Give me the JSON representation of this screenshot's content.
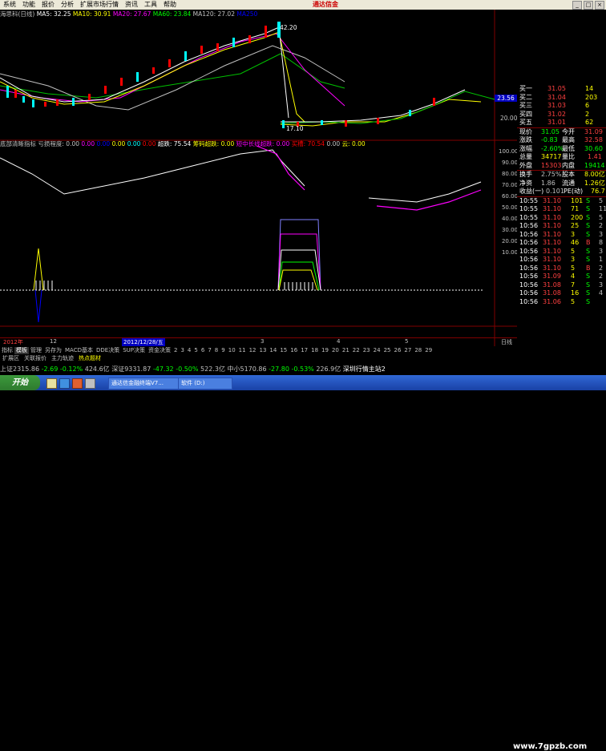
{
  "menu": [
    "系统",
    "功能",
    "报价",
    "分析",
    "扩展市场行情",
    "资讯",
    "工具",
    "帮助"
  ],
  "window_title": "通达信金",
  "ind_top": [
    {
      "t": "海思科(日线)",
      "c": "#c0c0c0"
    },
    {
      "t": "MA5: 32.25",
      "c": "#ffffff"
    },
    {
      "t": "MA10: 30.91",
      "c": "#ffff00"
    },
    {
      "t": "MA20: 27.67",
      "c": "#ff00ff"
    },
    {
      "t": "MA60: 23.84",
      "c": "#00ff00"
    },
    {
      "t": "MA120: 27.02",
      "c": "#c0c0c0"
    },
    {
      "t": "MA250",
      "c": "#0000ff"
    }
  ],
  "price_labels": {
    "hi": "42.20",
    "lo": "17.10",
    "cur": "23.56",
    "p1": "20.00"
  },
  "ind_mid": [
    {
      "t": "底部清晰指标",
      "c": "#c0c0c0"
    },
    {
      "t": "亏损程度: 0.00",
      "c": "#c0c0c0"
    },
    {
      "t": "0.00",
      "c": "#ff00ff"
    },
    {
      "t": "0.00",
      "c": "#0000ff"
    },
    {
      "t": "0.00",
      "c": "#ffff00"
    },
    {
      "t": "0.00",
      "c": "#00ffff"
    },
    {
      "t": "0.00",
      "c": "#ff0000"
    },
    {
      "t": "超跌: 75.54",
      "c": "#ffffff"
    },
    {
      "t": "筹码超跌: 0.00",
      "c": "#ffff00"
    },
    {
      "t": "短中长线超跌: 0.00",
      "c": "#ff00ff"
    },
    {
      "t": "买槽: 70.54",
      "c": "#ff0000"
    },
    {
      "t": "0.00",
      "c": "#c0c0c0"
    },
    {
      "t": "云: 0.00",
      "c": "#ffff00"
    }
  ],
  "axis_mid": [
    "100.00",
    "90.00",
    "80.00",
    "70.00",
    "60.00",
    "50.00",
    "40.00",
    "30.00",
    "20.00",
    "10.00"
  ],
  "time_axis": {
    "left": "2012年",
    "l2": "12",
    "l3": "2012/12/28/五",
    "l4": "3",
    "l5": "4",
    "l6": "5",
    "right": "日线"
  },
  "order_book": [
    {
      "label": "买二",
      "price": "31.04",
      "vol": "203"
    },
    {
      "label": "买三",
      "price": "31.03",
      "vol": "6"
    },
    {
      "label": "买四",
      "price": "31.02",
      "vol": "2"
    },
    {
      "label": "买五",
      "price": "31.01",
      "vol": "62"
    }
  ],
  "order_top": {
    "label": "买一",
    "price": "31.05",
    "vol": "14"
  },
  "quote": [
    {
      "l": "现价",
      "v": "31.05",
      "l2": "今开",
      "v2": "31.09"
    },
    {
      "l": "涨跌",
      "v": "-0.83",
      "l2": "最高",
      "v2": "32.58"
    },
    {
      "l": "涨幅",
      "v": "-2.60%",
      "l2": "最低",
      "v2": "30.60"
    },
    {
      "l": "总量",
      "v": "34717",
      "l2": "量比",
      "v2": "1.41"
    },
    {
      "l": "外盘",
      "v": "15303",
      "l2": "内盘",
      "v2": "19414"
    },
    {
      "l": "换手",
      "v": "2.75%",
      "l2": "股本",
      "v2": "8.00亿"
    },
    {
      "l": "净资",
      "v": "1.86",
      "l2": "流通",
      "v2": "1.26亿"
    },
    {
      "l": "收益(一)",
      "v": "0.101",
      "l2": "PE(动)",
      "v2": "76.7"
    }
  ],
  "ticks": [
    {
      "t": "10:55",
      "p": "31.10",
      "v": "101",
      "s": "S",
      "n": "5"
    },
    {
      "t": "10:55",
      "p": "31.10",
      "v": "71",
      "s": "S",
      "n": "11"
    },
    {
      "t": "10:55",
      "p": "31.10",
      "v": "200",
      "s": "S",
      "n": "5"
    },
    {
      "t": "10:56",
      "p": "31.10",
      "v": "25",
      "s": "S",
      "n": "2"
    },
    {
      "t": "10:56",
      "p": "31.10",
      "v": "3",
      "s": "S",
      "n": "3"
    },
    {
      "t": "10:56",
      "p": "31.10",
      "v": "46",
      "s": "B",
      "n": "8"
    },
    {
      "t": "10:56",
      "p": "31.10",
      "v": "5",
      "s": "S",
      "n": "3"
    },
    {
      "t": "10:56",
      "p": "31.10",
      "v": "3",
      "s": "S",
      "n": "1"
    },
    {
      "t": "10:56",
      "p": "31.10",
      "v": "5",
      "s": "B",
      "n": "2"
    },
    {
      "t": "10:56",
      "p": "31.09",
      "v": "4",
      "s": "S",
      "n": "2"
    },
    {
      "t": "10:56",
      "p": "31.08",
      "v": "7",
      "s": "S",
      "n": "3"
    },
    {
      "t": "10:56",
      "p": "31.08",
      "v": "16",
      "s": "S",
      "n": "4"
    }
  ],
  "tick_ch": [
    "10:56",
    "31.06",
    "5",
    "S"
  ],
  "bottom_tabs": [
    "指标",
    "模板",
    "管理",
    "另存为",
    "MACD基本",
    "DDE决策",
    "SUP决策",
    "资金决策",
    "2",
    "3",
    "4",
    "5",
    "6",
    "7",
    "8",
    "9",
    "10",
    "11",
    "12",
    "13",
    "14",
    "15",
    "16",
    "17",
    "18",
    "19",
    "20",
    "21",
    "22",
    "23",
    "24",
    "25",
    "26",
    "27",
    "28",
    "29"
  ],
  "bottom_tabs2": [
    "扩展区",
    "关联报价",
    "主力轨迹",
    "热点题材"
  ],
  "status": [
    {
      "t": "上证2315.86",
      "c": "#c0c0c0"
    },
    {
      "t": "-2.69",
      "c": "#00ff00"
    },
    {
      "t": "-0.12%",
      "c": "#00ff00"
    },
    {
      "t": "424.6亿",
      "c": "#c0c0c0"
    },
    {
      "t": "深证9331.87",
      "c": "#c0c0c0"
    },
    {
      "t": "-47.32",
      "c": "#00ff00"
    },
    {
      "t": "-0.50%",
      "c": "#00ff00"
    },
    {
      "t": "522.3亿",
      "c": "#c0c0c0"
    },
    {
      "t": "中小5170.86",
      "c": "#c0c0c0"
    },
    {
      "t": "-27.80",
      "c": "#00ff00"
    },
    {
      "t": "-0.53%",
      "c": "#00ff00"
    },
    {
      "t": "226.9亿",
      "c": "#c0c0c0"
    },
    {
      "t": "深圳行情主站2",
      "c": "#ffffff"
    }
  ],
  "taskbar": {
    "start": "开始",
    "t1": "通达信金融终端V7...",
    "t2": "软件 (D:)"
  },
  "watermark": "www.7gpzb.com"
}
